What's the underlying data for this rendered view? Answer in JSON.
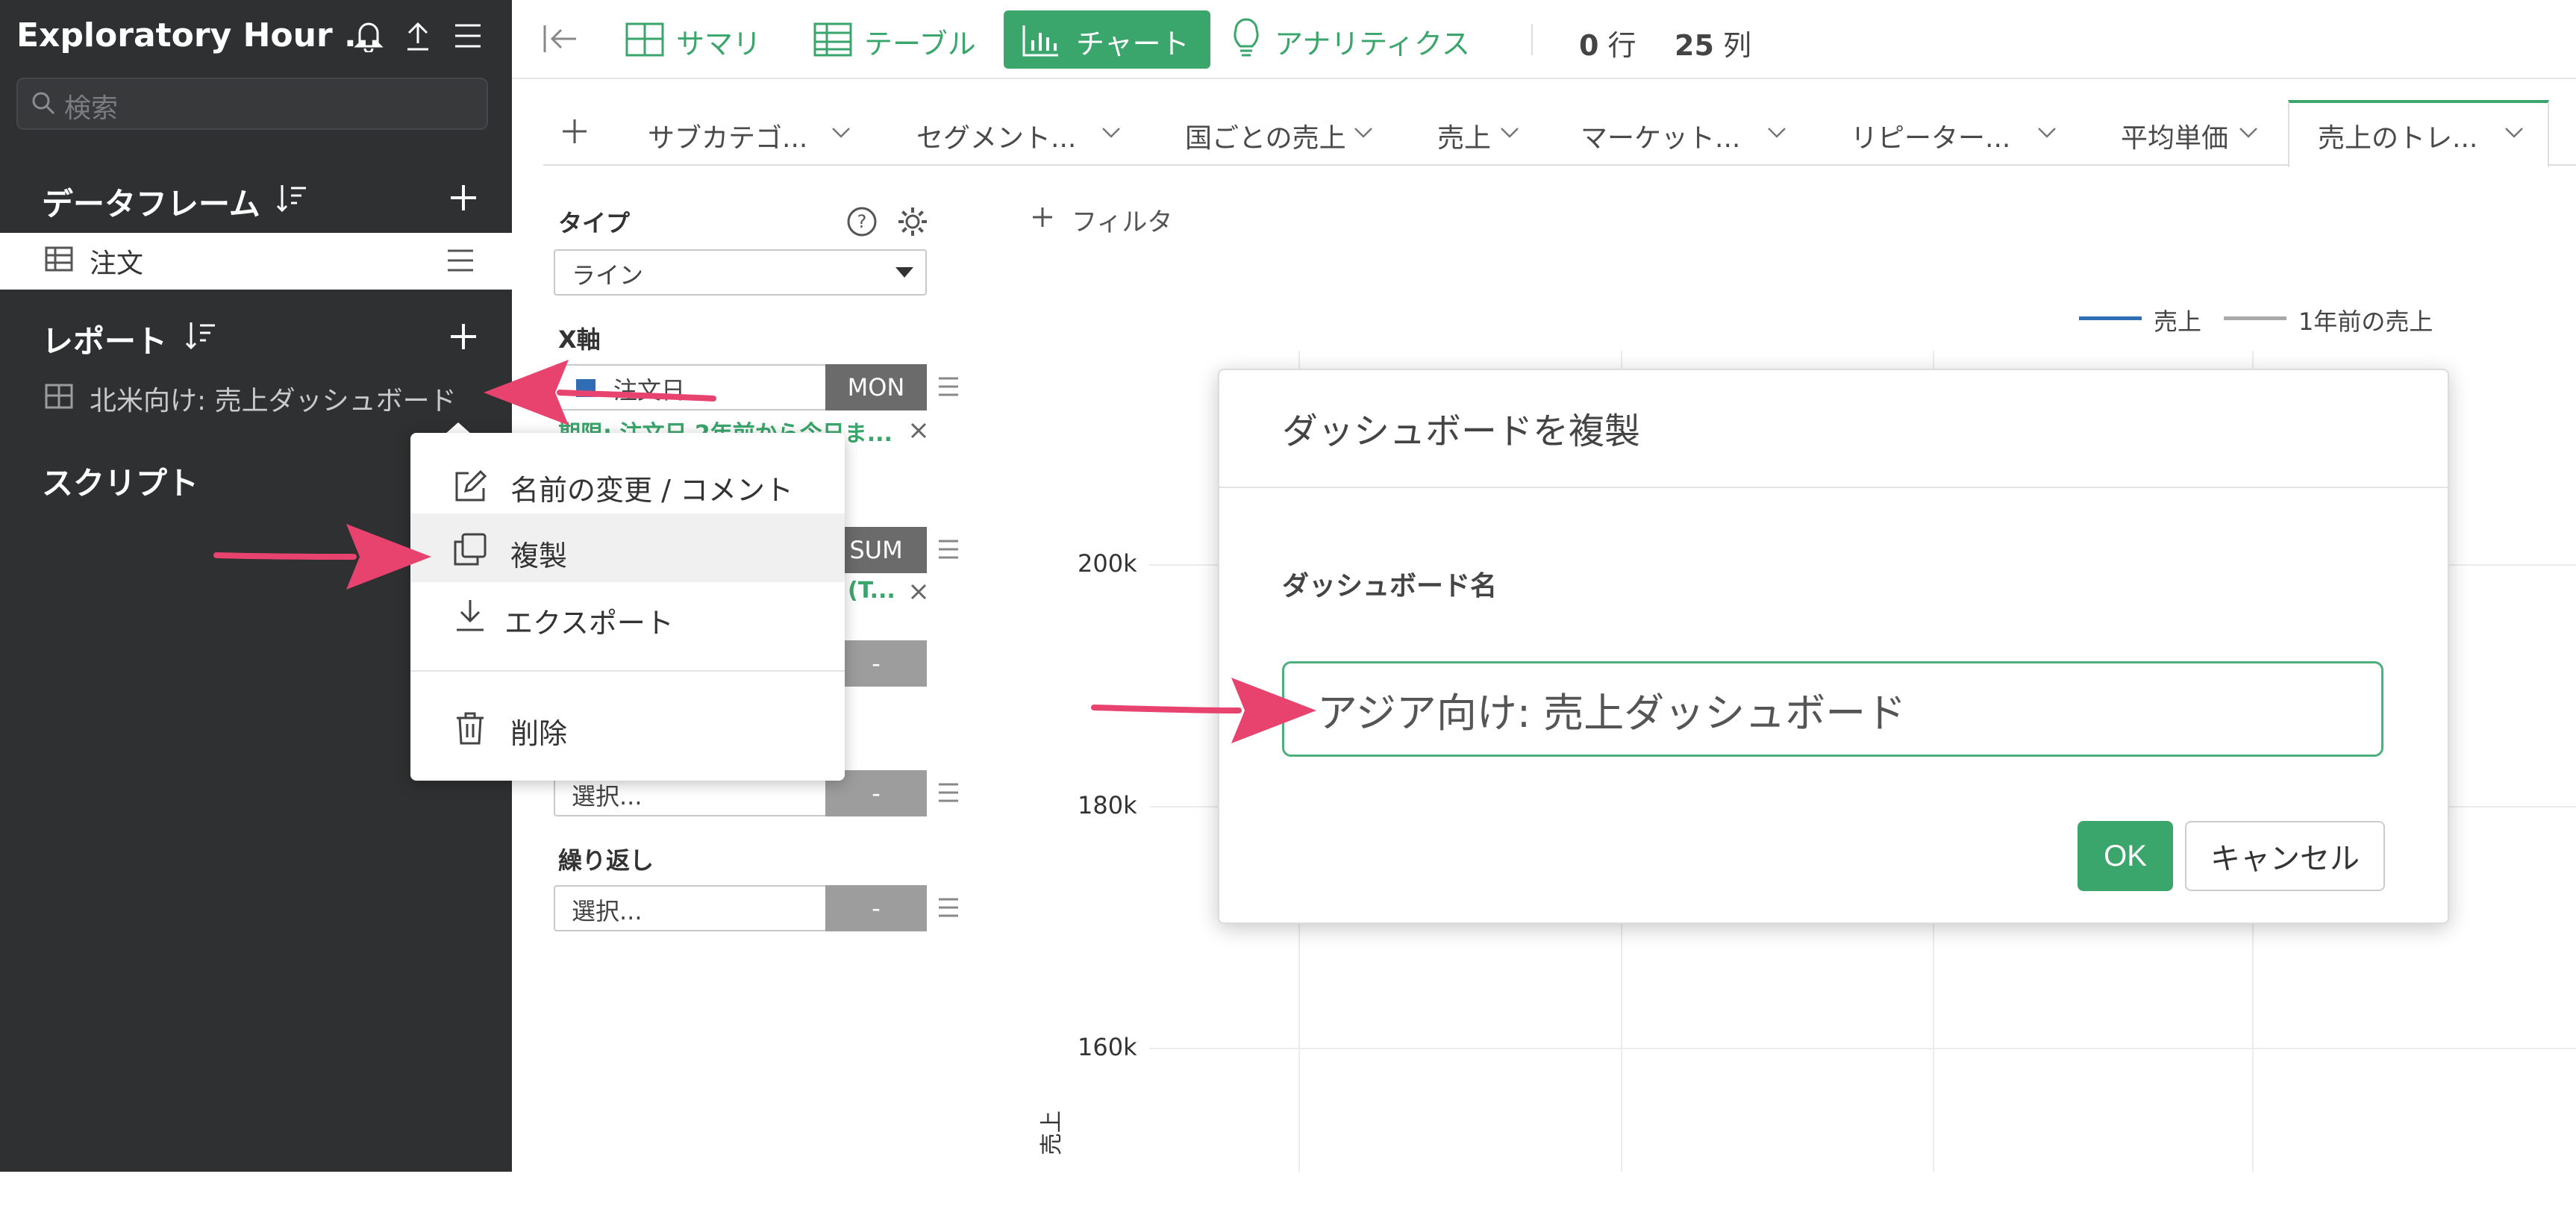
{
  "sidebar": {
    "app_title": "Exploratory Hour ...",
    "search_placeholder": "検索",
    "dataframe_section": "データフレーム",
    "dataframe_item": "注文",
    "report_section": "レポート",
    "report_item": "北米向け: 売上ダッシュボード",
    "script_section": "スクリプト"
  },
  "toolbar": {
    "tabs": [
      "サマリ",
      "テーブル",
      "チャート",
      "アナリティクス"
    ],
    "active_tab": "チャート",
    "rows_count": "0",
    "rows_unit": "行",
    "cols_count": "25",
    "cols_unit": "列"
  },
  "chart_tabs": [
    "サブカテゴ...",
    "セグメント...",
    "国ごとの売上",
    "売上",
    "マーケット...",
    "リピーター...",
    "平均単価",
    "売上のトレ..."
  ],
  "active_chart_tab": "売上のトレ...",
  "config": {
    "type_label": "タイプ",
    "type_value": "ライン",
    "x_axis_label": "X軸",
    "x_axis_value": "注文日",
    "x_axis_unit": "MON",
    "filter_text": "期限: 注文日 2年前から今日ま...",
    "y_unit": "SUM",
    "y_partial": "(T...",
    "dash1": "-",
    "select_placeholder": "選択...",
    "dash2": "-",
    "repeat_label": "繰り返し",
    "repeat_value": "選択...",
    "dash3": "-"
  },
  "chart": {
    "filter_button": "フィルタ",
    "legend": [
      "売上",
      "1年前の売上"
    ],
    "y_ticks": [
      "200k",
      "180k",
      "160k"
    ],
    "y_axis_label": "売上"
  },
  "context_menu": {
    "items": [
      "名前の変更 / コメント",
      "複製",
      "エクスポート",
      "削除"
    ]
  },
  "modal": {
    "title": "ダッシュボードを複製",
    "field_label": "ダッシュボード名",
    "input_value": "アジア向け: 売上ダッシュボード",
    "ok_label": "OK",
    "cancel_label": "キャンセル"
  },
  "colors": {
    "accent": "#3aa66b",
    "sidebar_bg": "#2e3031",
    "arrow": "#e8436e",
    "legend_sales": "#2f6db5",
    "legend_prev": "#a9a9a9"
  }
}
